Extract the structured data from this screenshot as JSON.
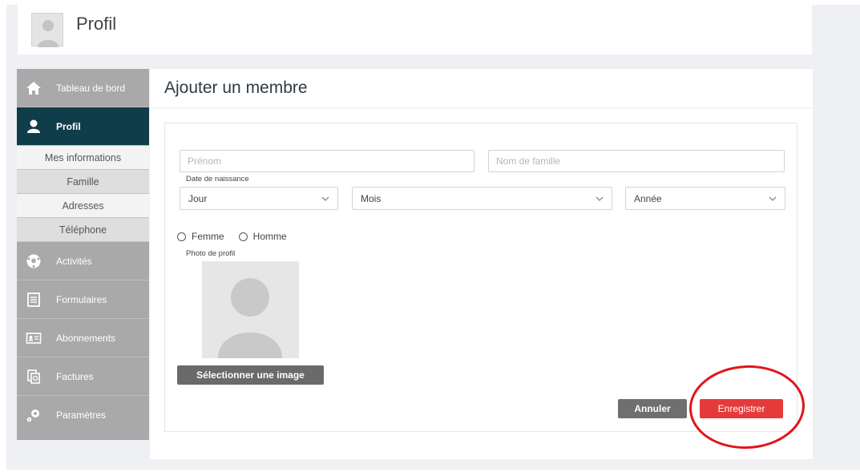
{
  "header": {
    "title": "Profil"
  },
  "sidebar": {
    "items": [
      {
        "label": "Tableau de bord",
        "icon": "home-icon"
      },
      {
        "label": "Profil",
        "icon": "user-icon"
      },
      {
        "label": "Activités",
        "icon": "soccer-ball-icon"
      },
      {
        "label": "Formulaires",
        "icon": "document-icon"
      },
      {
        "label": "Abonnements",
        "icon": "id-card-icon"
      },
      {
        "label": "Factures",
        "icon": "invoice-icon"
      },
      {
        "label": "Paramètres",
        "icon": "gears-icon"
      }
    ],
    "subitems": [
      "Mes informations",
      "Famille",
      "Adresses",
      "Téléphone"
    ]
  },
  "main": {
    "title": "Ajouter un membre",
    "form": {
      "first_name_placeholder": "Prénom",
      "last_name_placeholder": "Nom de famille",
      "birthdate_label": "Date de naissance",
      "day": "Jour",
      "month": "Mois",
      "year": "Année",
      "gender_female": "Femme",
      "gender_male": "Homme",
      "photo_label": "Photo de profil",
      "select_image": "Sélectionner une image",
      "cancel": "Annuler",
      "save": "Enregistrer"
    }
  },
  "colors": {
    "active_nav": "#0f3d4a",
    "sidebar": "#a9a9a9",
    "save_button": "#e53a3a",
    "annotation": "#e0141b"
  }
}
